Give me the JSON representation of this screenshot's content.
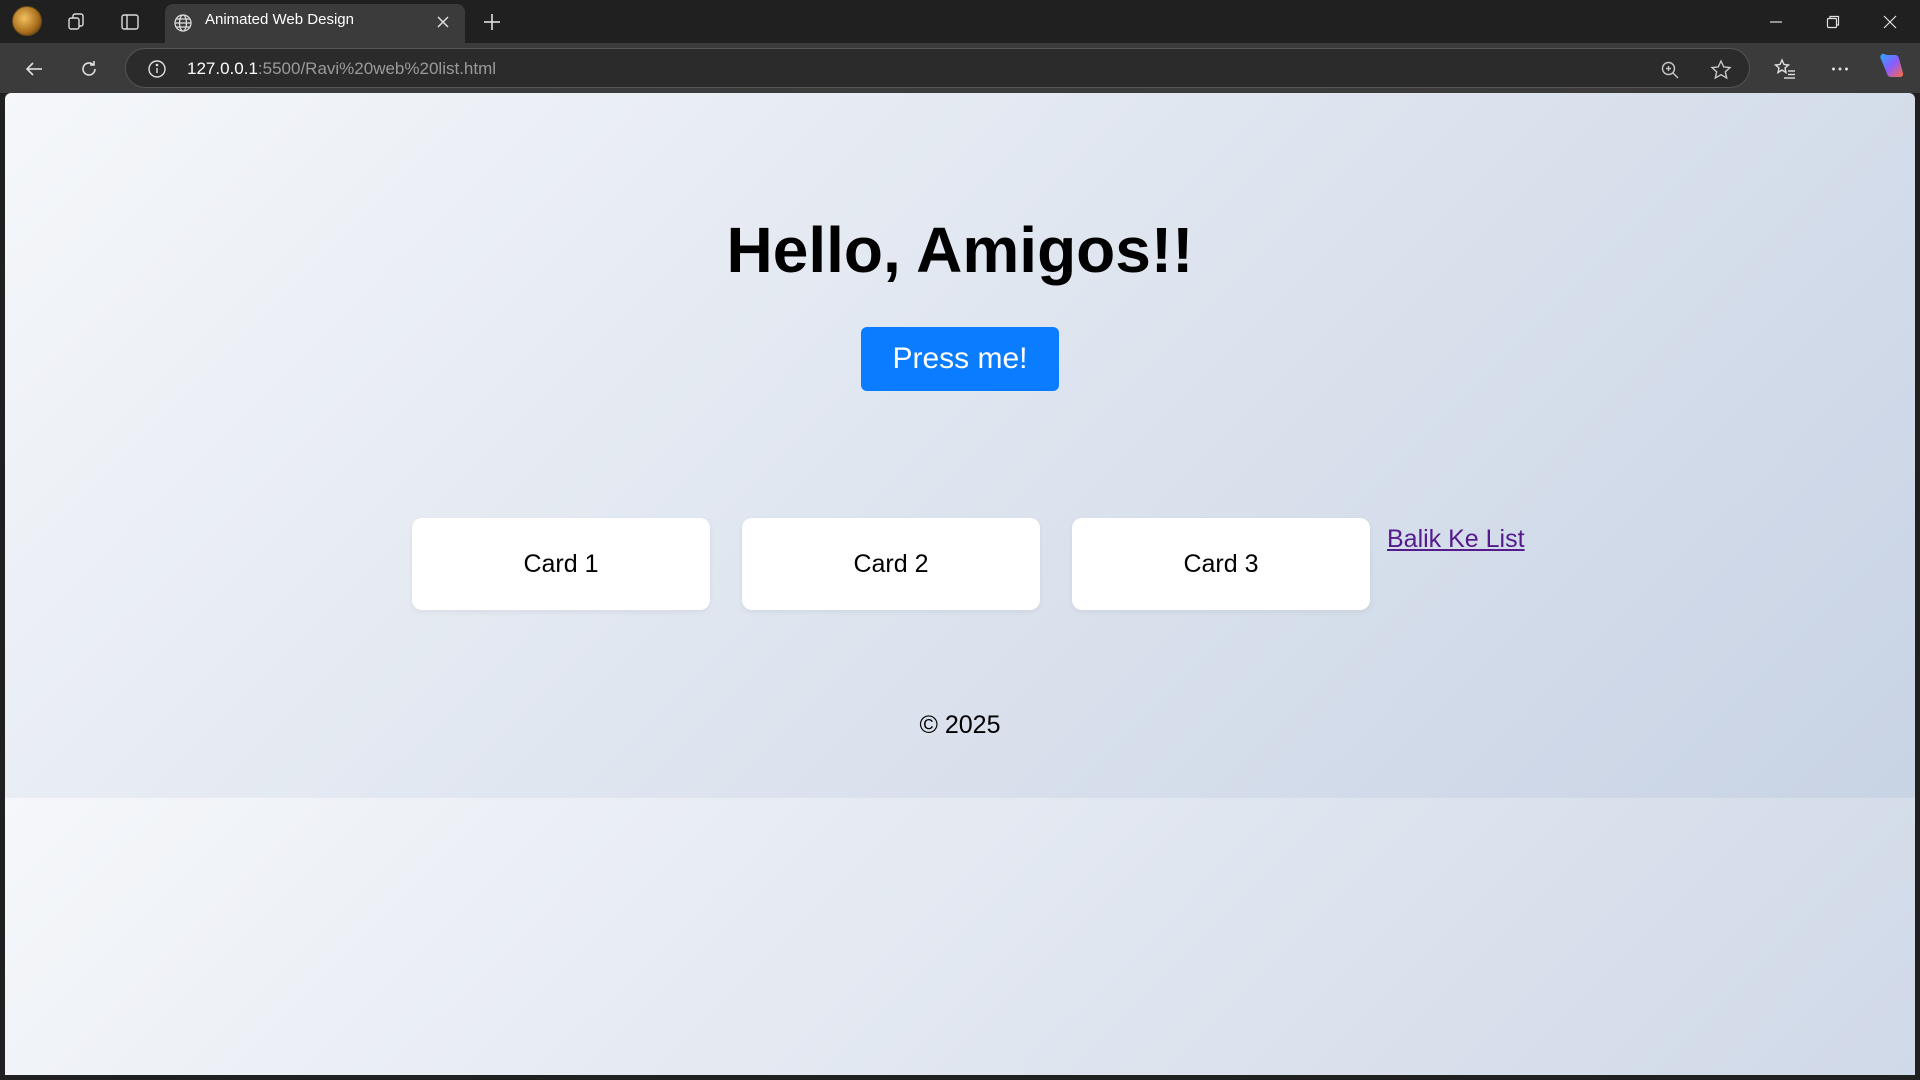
{
  "browser": {
    "tab_title": "Animated Web Design",
    "url_host": "127.0.0.1",
    "url_rest": ":5500/Ravi%20web%20list.html",
    "icons": {
      "profile": "profile-avatar",
      "workspaces": "workspaces-icon",
      "tab_actions": "vertical-tabs-icon",
      "site": "globe-icon",
      "close_tab": "close-icon",
      "new_tab": "plus-icon",
      "back": "back-arrow-icon",
      "refresh": "refresh-icon",
      "info": "info-icon",
      "zoom": "zoom-icon",
      "favorite": "star-icon",
      "favorites": "favorites-icon",
      "more": "more-icon",
      "copilot": "copilot-icon"
    }
  },
  "page": {
    "heading": "Hello, Amigos!!",
    "button_label": "Press me!",
    "cards": [
      "Card 1",
      "Card 2",
      "Card 3"
    ],
    "link_text": "Balik Ke List",
    "footer": "© 2025"
  },
  "colors": {
    "button_bg": "#0a7cff",
    "link": "#551a8b",
    "page_gradient_start": "#f5f7fa",
    "page_gradient_end": "#c3cfe2"
  }
}
